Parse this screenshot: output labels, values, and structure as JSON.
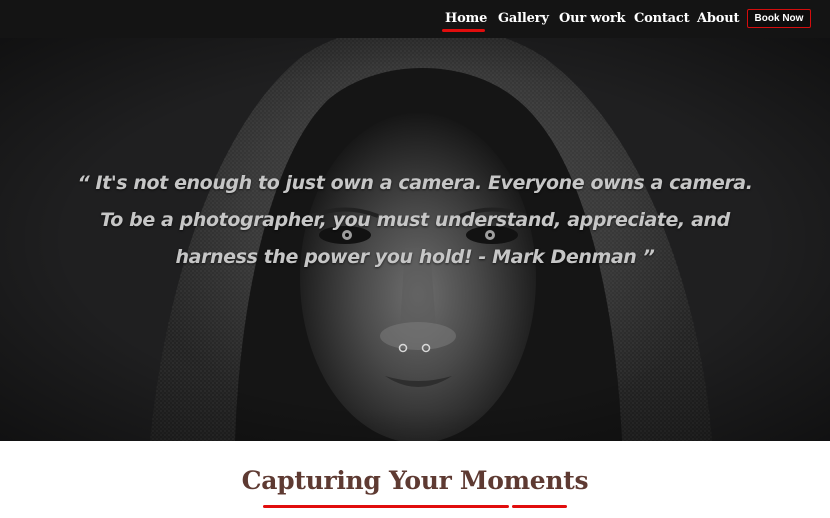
{
  "nav": {
    "items": [
      {
        "label": "Home",
        "active": true
      },
      {
        "label": "Gallery"
      },
      {
        "label": "Our work"
      },
      {
        "label": "Contact"
      },
      {
        "label": "About"
      }
    ],
    "cta_label": "Book Now"
  },
  "hero": {
    "quote": "“ It's not enough to just own a camera. Everyone owns a camera. To be a photographer, you must understand, appreciate, and harness the power you hold! - Mark Denman ”"
  },
  "section": {
    "title": "Capturing Your Moments"
  },
  "colors": {
    "accent": "#e10d0d",
    "nav_bg": "#141414",
    "hero_bg": "#1f1f20",
    "title": "#5e3a32"
  },
  "icons": {
    "hero_image": "hooded-portrait-photo"
  }
}
